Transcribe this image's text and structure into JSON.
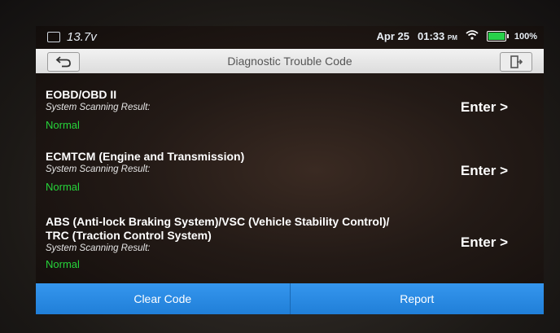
{
  "status": {
    "voltage": "13.7v",
    "date": "Apr 25",
    "time": "01:33",
    "ampm": "PM",
    "battery": "100%"
  },
  "header": {
    "title": "Diagnostic Trouble Code"
  },
  "systems": [
    {
      "title_line1": "EOBD/OBD II",
      "title_line2": "",
      "subtitle": "System Scanning Result:",
      "status": "Normal",
      "action": "Enter >"
    },
    {
      "title_line1": "ECMTCM (Engine and Transmission)",
      "title_line2": "",
      "subtitle": "System Scanning Result:",
      "status": "Normal",
      "action": "Enter >"
    },
    {
      "title_line1": "ABS (Anti-lock Braking System)/VSC (Vehicle Stability Control)/",
      "title_line2": "TRC (Traction Control System)",
      "subtitle": "System Scanning Result:",
      "status": "Normal",
      "action": "Enter >"
    }
  ],
  "footer": {
    "clear_label": "Clear Code",
    "report_label": "Report"
  },
  "colors": {
    "normal": "#26d43a",
    "button_blue": "#2c8ce6",
    "toolbar": "#e6e6e6"
  },
  "icons": {
    "back": "back-arrow-icon",
    "exit": "exit-door-icon",
    "wifi": "wifi-icon",
    "battery": "battery-icon",
    "calendar": "calendar-icon"
  }
}
